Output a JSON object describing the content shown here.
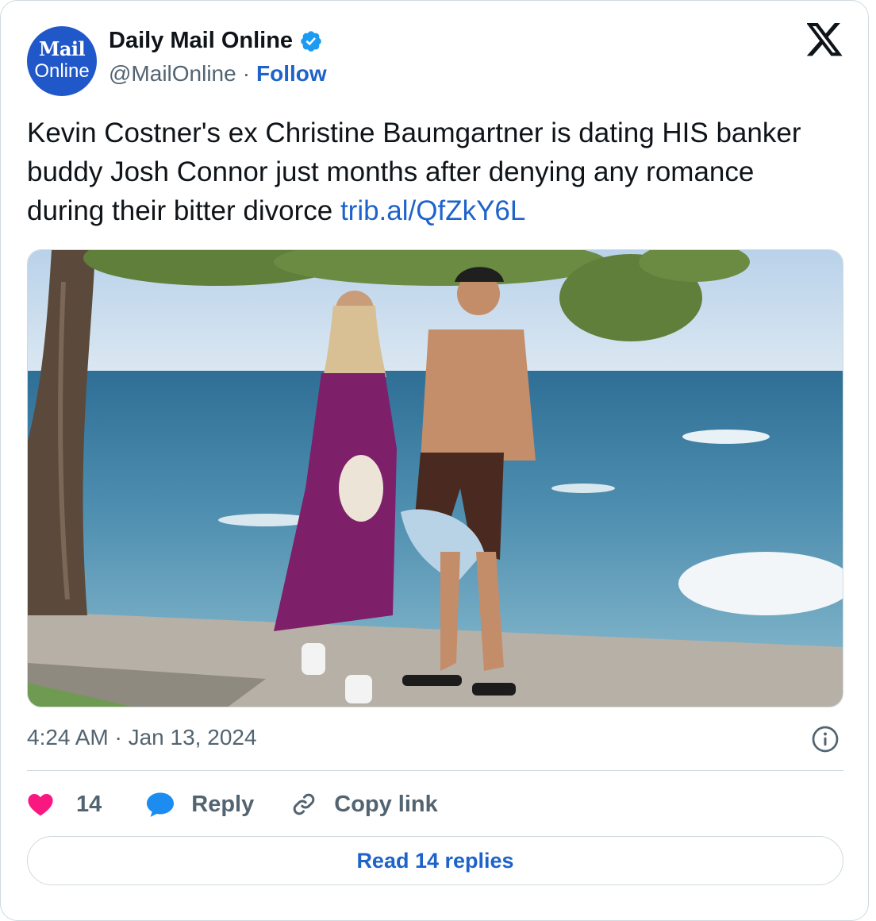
{
  "account": {
    "avatar_line1": "Mail",
    "avatar_line2": "Online",
    "name": "Daily Mail Online",
    "handle": "@MailOnline",
    "separator": "·",
    "follow_label": "Follow",
    "verified": true
  },
  "tweet": {
    "text": "Kevin Costner's ex Christine Baumgartner is dating HIS banker buddy Josh Connor just months after denying any romance during their bitter divorce",
    "link": "trib.al/QfZkY6L",
    "timestamp": "4:24 AM · Jan 13, 2024",
    "photo_alt": "Woman in purple dress and man in swim shorts walking along a beach path under a tree"
  },
  "actions": {
    "like_count": "14",
    "reply_label": "Reply",
    "copy_label": "Copy link",
    "read_replies_label": "Read 14 replies"
  },
  "icons": {
    "x_logo": "x-logo-icon",
    "verified": "verified-badge-icon",
    "info": "info-icon",
    "like": "heart-icon",
    "reply": "reply-bubble-icon",
    "copy": "link-icon"
  },
  "colors": {
    "accent": "#1d63c9",
    "like": "#f91880",
    "reply": "#1d8cf0",
    "muted": "#536471",
    "avatar_bg": "#2158c9"
  }
}
